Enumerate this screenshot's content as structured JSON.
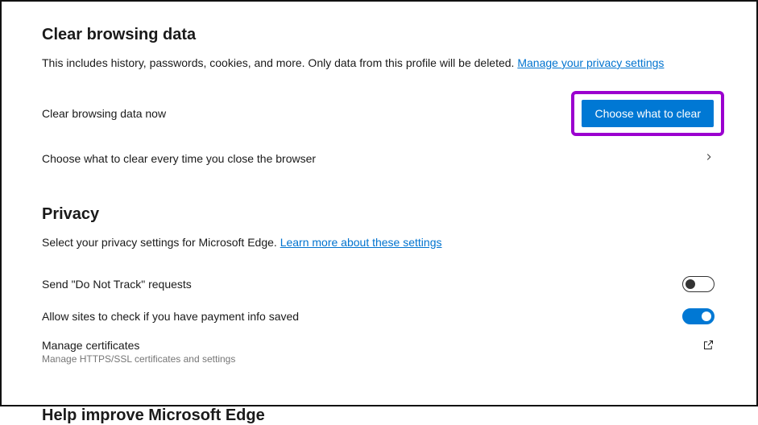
{
  "clearData": {
    "title": "Clear browsing data",
    "subtitle_pre": "This includes history, passwords, cookies, and more. Only data from this profile will be deleted. ",
    "subtitle_link": "Manage your privacy settings",
    "row_now_label": "Clear browsing data now",
    "choose_button_label": "Choose what to clear",
    "row_onclose_label": "Choose what to clear every time you close the browser"
  },
  "privacy": {
    "title": "Privacy",
    "subtitle_pre": "Select your privacy settings for Microsoft Edge. ",
    "subtitle_link": "Learn more about these settings",
    "dnt_label": "Send \"Do Not Track\" requests",
    "dnt_on": false,
    "payment_label": "Allow sites to check if you have payment info saved",
    "payment_on": true,
    "certs_label": "Manage certificates",
    "certs_sub": "Manage HTTPS/SSL certificates and settings"
  },
  "help": {
    "title": "Help improve Microsoft Edge"
  }
}
